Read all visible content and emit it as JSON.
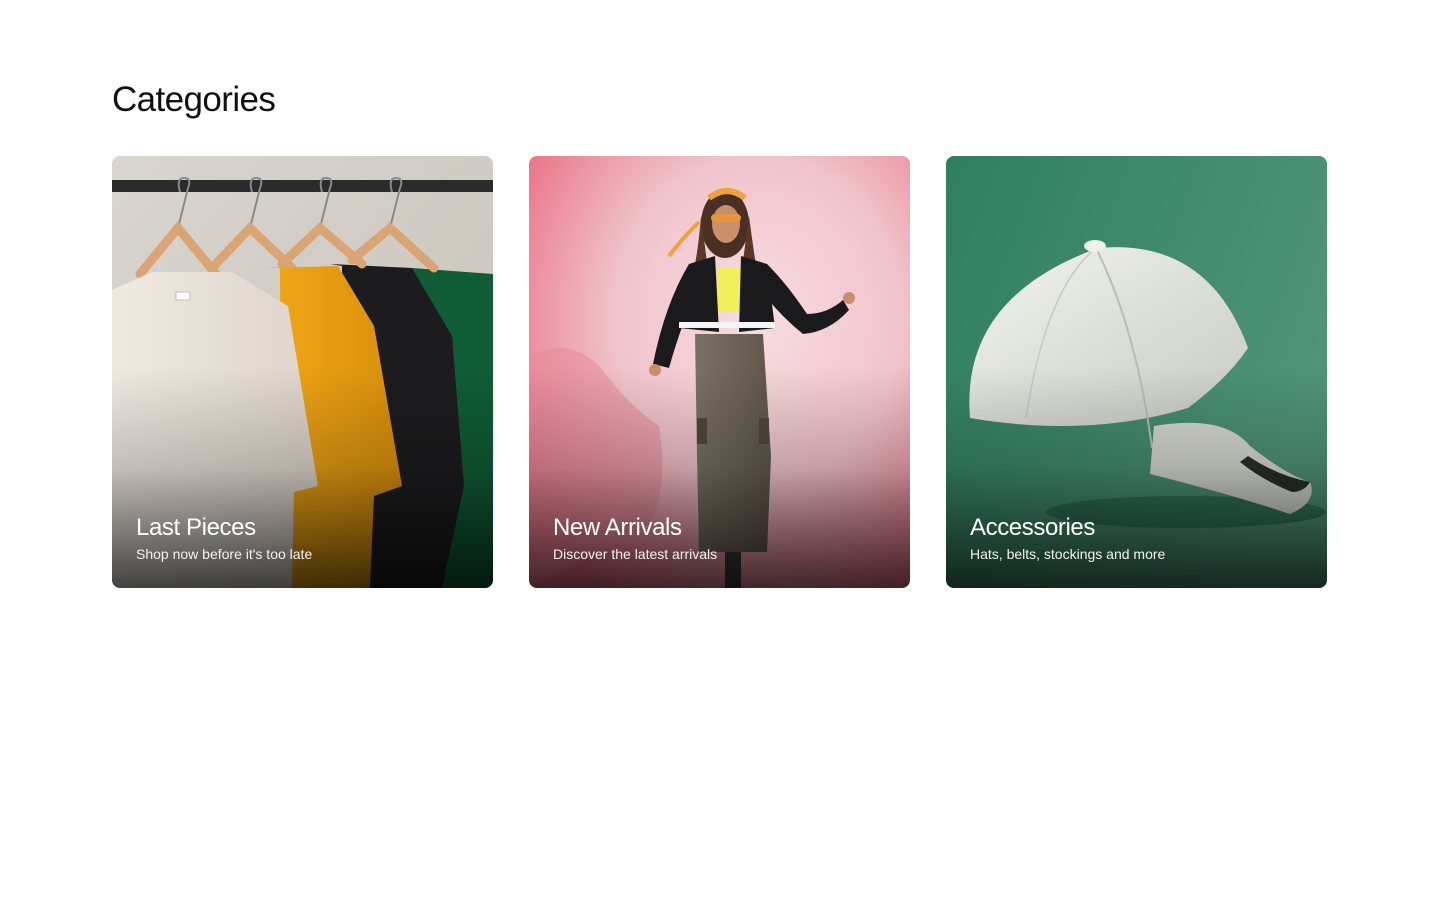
{
  "page": {
    "title": "Categories"
  },
  "categories": [
    {
      "title": "Last Pieces",
      "subtitle": "Shop now before it's too late",
      "image": "t-shirts-on-hangers"
    },
    {
      "title": "New Arrivals",
      "subtitle": "Discover the latest arrivals",
      "image": "woman-in-varsity-jacket"
    },
    {
      "title": "Accessories",
      "subtitle": "Hats, belts, stockings and more",
      "image": "white-baseball-cap"
    }
  ],
  "colors": {
    "background": "#ffffff",
    "title_text": "#111111",
    "caption_text": "#ffffff",
    "accessories_bg": "#2f7f62",
    "new_arrivals_bg": "#f3a9b4"
  }
}
